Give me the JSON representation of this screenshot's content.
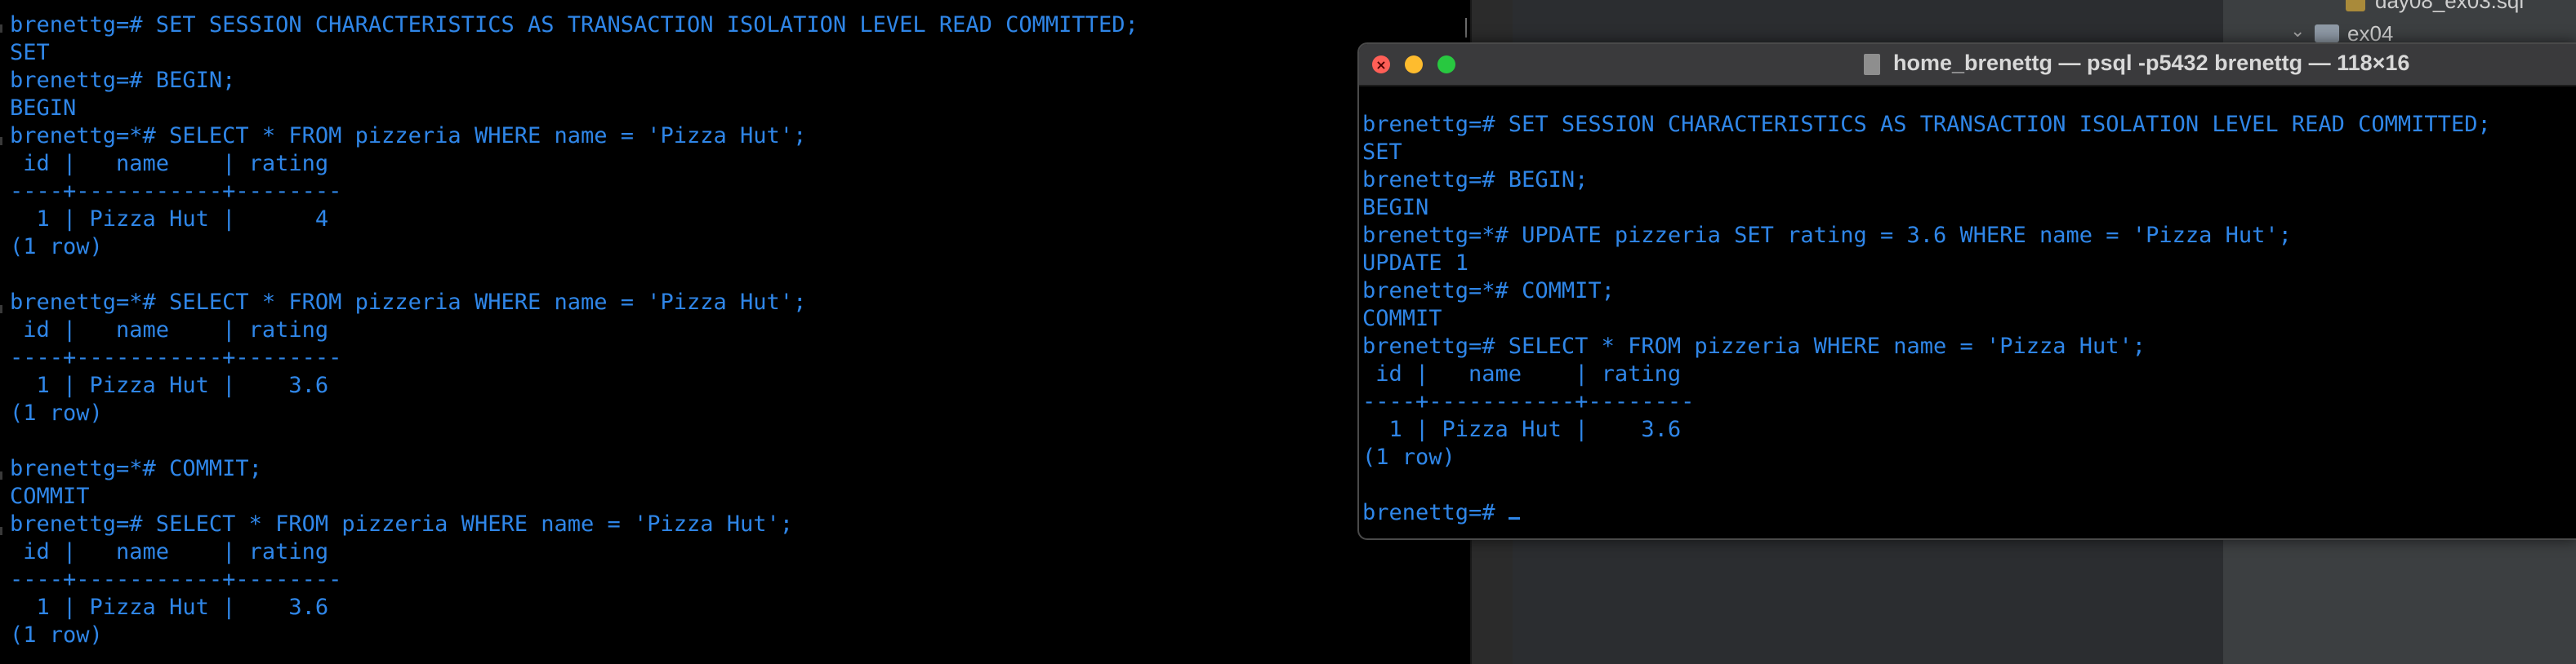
{
  "left_terminal": {
    "lines": [
      "brenettg=# SET SESSION CHARACTERISTICS AS TRANSACTION ISOLATION LEVEL READ COMMITTED;",
      "SET",
      "brenettg=# BEGIN;",
      "BEGIN",
      "brenettg=*# SELECT * FROM pizzeria WHERE name = 'Pizza Hut';",
      " id |   name    | rating",
      "----+-----------+--------",
      "  1 | Pizza Hut |      4",
      "(1 row)",
      "",
      "brenettg=*# SELECT * FROM pizzeria WHERE name = 'Pizza Hut';",
      " id |   name    | rating",
      "----+-----------+--------",
      "  1 | Pizza Hut |    3.6",
      "(1 row)",
      "",
      "brenettg=*# COMMIT;",
      "COMMIT",
      "brenettg=# SELECT * FROM pizzeria WHERE name = 'Pizza Hut';",
      " id |   name    | rating",
      "----+-----------+--------",
      "  1 | Pizza Hut |    3.6",
      "(1 row)"
    ]
  },
  "right_terminal": {
    "title": "home_brenettg — psql -p5432 brenettg — 118×16",
    "lines": [
      "brenettg=# SET SESSION CHARACTERISTICS AS TRANSACTION ISOLATION LEVEL READ COMMITTED;",
      "SET",
      "brenettg=# BEGIN;",
      "BEGIN",
      "brenettg=*# UPDATE pizzeria SET rating = 3.6 WHERE name = 'Pizza Hut';",
      "UPDATE 1",
      "brenettg=*# COMMIT;",
      "COMMIT",
      "brenettg=# SELECT * FROM pizzeria WHERE name = 'Pizza Hut';",
      " id |   name    | rating",
      "----+-----------+--------",
      "  1 | Pizza Hut |    3.6",
      "(1 row)",
      ""
    ],
    "prompt": "brenettg=# ",
    "controls": {
      "close_glyph": "×",
      "minimize_glyph": "",
      "zoom_glyph": ""
    }
  },
  "project_panel": {
    "file_name": "day08_ex03.sql",
    "folder_name": "ex04"
  },
  "colors": {
    "terminal_text": "#2f86e8",
    "terminal_bg": "#000000"
  }
}
